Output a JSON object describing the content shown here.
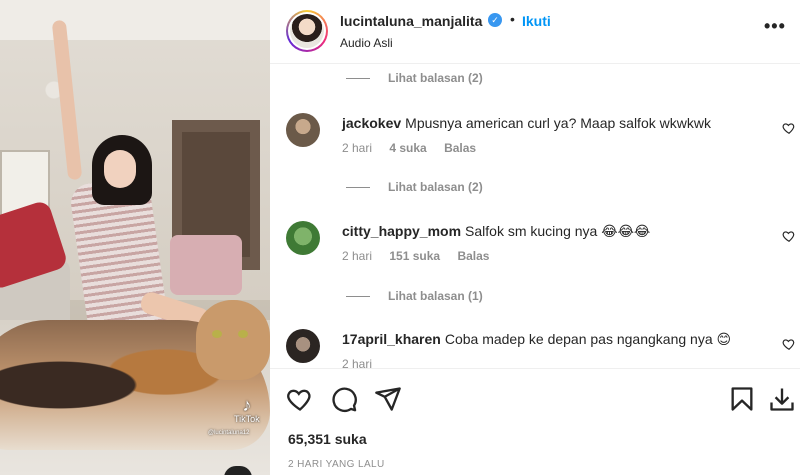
{
  "header": {
    "username": "lucintaluna_manjalita",
    "verified_mark": "✓",
    "separator": "•",
    "follow_label": "Ikuti",
    "audio": "Audio Asli",
    "more_label": "•••"
  },
  "media": {
    "tiktok_label": "TikTok",
    "tiktok_logo": "♪",
    "tiktok_handle": "@lucintaluna12"
  },
  "comments": {
    "reply_toggles": [
      "Lihat balasan (2)",
      "Lihat balasan (2)",
      "Lihat balasan (1)"
    ],
    "items": [
      {
        "username": "jackokev",
        "text": "Mpusnya american curl ya? Maap salfok wkwkwk",
        "time": "2 hari",
        "likes": "4 suka",
        "reply": "Balas",
        "avatar_color": "#6b5a49"
      },
      {
        "username": "citty_happy_mom",
        "text": "Salfok sm kucing nya 😂😂😂",
        "time": "2 hari",
        "likes": "151 suka",
        "reply": "Balas",
        "avatar_color": "#3f7a35"
      },
      {
        "username": "17april_kharen",
        "text": "Coba madep ke depan pas ngangkang nya 😊",
        "time": "2 hari",
        "likes": "",
        "reply": "",
        "avatar_color": "#2b2522"
      }
    ]
  },
  "footer": {
    "likes": "65,351 suka",
    "date": "2 HARI YANG LALU"
  },
  "icons": {
    "like": "heart-icon",
    "comment": "comment-icon",
    "share": "send-icon",
    "save": "bookmark-icon",
    "download": "download-icon"
  },
  "colors": {
    "accent": "#0095f6",
    "verified": "#3897f0",
    "muted": "#8e8e8e",
    "text": "#262626"
  }
}
